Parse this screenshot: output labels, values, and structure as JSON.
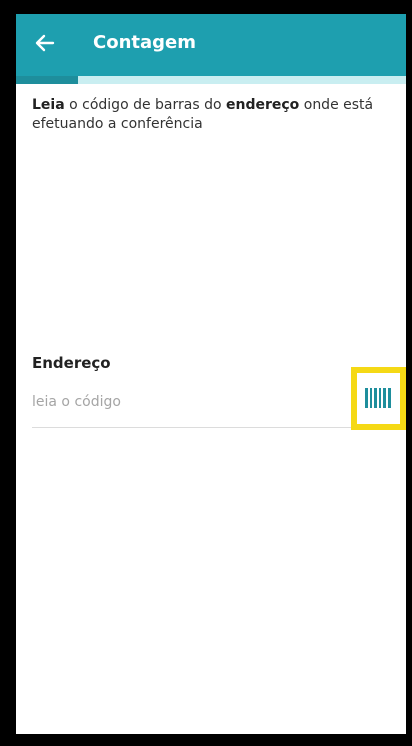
{
  "app_bar": {
    "title": "Contagem",
    "back_icon": "arrow-left-icon",
    "color": "#1e9faf"
  },
  "progress": {
    "fraction": 0.16,
    "fill_color": "#1e8e9c",
    "track_color": "#c9eef1"
  },
  "instruction": {
    "part1_bold": "Leia",
    "part2": " o código de barras do ",
    "part3_bold": "endereço",
    "part4": " onde está efetuando a conferência"
  },
  "address_field": {
    "label": "Endereço",
    "value": "",
    "placeholder": "leia o código",
    "scan_icon": "barcode-icon",
    "highlight_color": "#f5d915",
    "icon_color": "#1e8e9c"
  }
}
